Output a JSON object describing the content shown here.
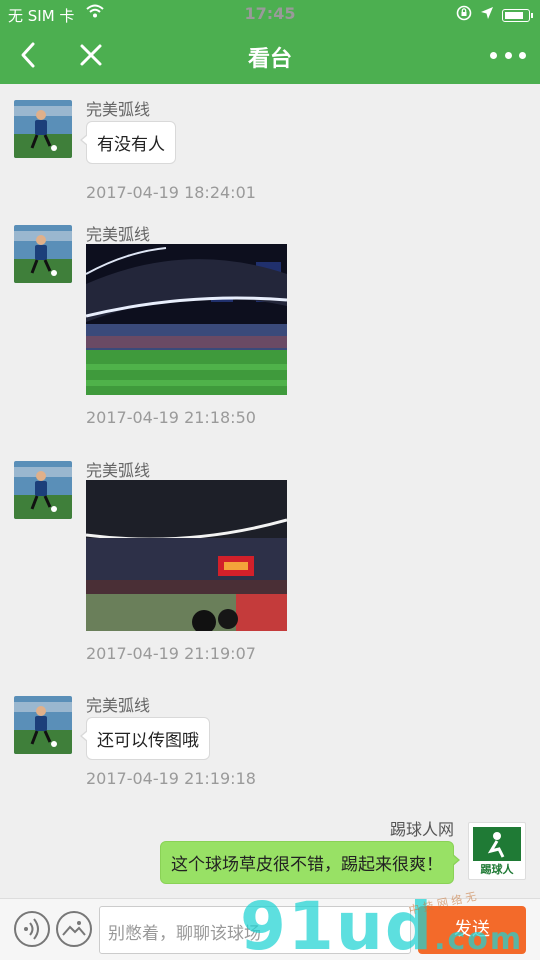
{
  "status_bar": {
    "carrier": "无 SIM 卡",
    "time": "17:45",
    "battery_level": 0.85
  },
  "nav": {
    "title": "看台",
    "back_icon": "chevron-left-icon",
    "close_icon": "close-icon",
    "more_icon": "more-dots-icon"
  },
  "messages": [
    {
      "sender": "完美弧线",
      "type": "text",
      "text": "有没有人",
      "time": "2017-04-19 18:24:01"
    },
    {
      "sender": "完美弧线",
      "type": "image",
      "image_desc": "stadium-night",
      "time": "2017-04-19 21:18:50"
    },
    {
      "sender": "完美弧线",
      "type": "image",
      "image_desc": "stadium-scoreboard",
      "time": "2017-04-19 21:19:07"
    },
    {
      "sender": "完美弧线",
      "type": "text",
      "text": "还可以传图哦",
      "time": "2017-04-19 21:19:18"
    },
    {
      "sender": "踢球人网",
      "type": "text",
      "text": "这个球场草皮很不错，踢起来很爽！",
      "mine": true,
      "logo_text": "踢球人"
    }
  ],
  "input_bar": {
    "placeholder": "别憋着，聊聊该球场",
    "send_label": "发送",
    "voice_icon": "voice-icon",
    "image_icon": "image-icon"
  },
  "watermark": {
    "text": "91ud",
    "suffix": ".com",
    "small": "中 技 网 络 无"
  },
  "colors": {
    "nav_green": "#4caf50",
    "bubble_green": "#98e165",
    "send_orange": "#f36a2a"
  }
}
